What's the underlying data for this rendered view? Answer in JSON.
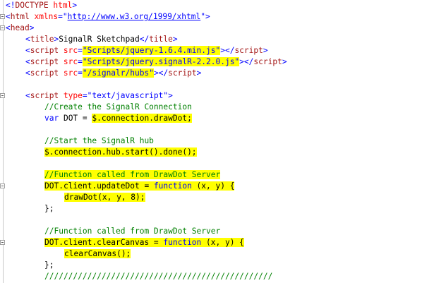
{
  "lines": [
    [
      [
        "<!",
        "c-blue"
      ],
      [
        "DOCTYPE",
        "c-maroon"
      ],
      [
        " ",
        "c-black"
      ],
      [
        "html",
        "c-red"
      ],
      [
        ">",
        "c-blue"
      ]
    ],
    [
      [
        "<",
        "c-blue"
      ],
      [
        "html",
        "c-maroon"
      ],
      [
        " ",
        "c-black"
      ],
      [
        "xmlns",
        "c-red"
      ],
      [
        "=\"",
        "c-blue"
      ],
      [
        "http://www.w3.org/1999/xhtml",
        "c-link"
      ],
      [
        "\">",
        "c-blue"
      ]
    ],
    [
      [
        "<",
        "c-blue"
      ],
      [
        "head",
        "c-maroon"
      ],
      [
        ">",
        "c-blue"
      ]
    ],
    [
      [
        "<",
        "c-blue"
      ],
      [
        "title",
        "c-maroon"
      ],
      [
        ">",
        "c-blue"
      ],
      [
        "SignalR Sketchpad",
        "c-black"
      ],
      [
        "</",
        "c-blue"
      ],
      [
        "title",
        "c-maroon"
      ],
      [
        ">",
        "c-blue"
      ]
    ],
    [
      [
        "<",
        "c-blue"
      ],
      [
        "script",
        "c-maroon"
      ],
      [
        " ",
        "c-black"
      ],
      [
        "src",
        "c-red"
      ],
      [
        "=",
        "c-blue"
      ],
      [
        "\"Scripts/jquery-1.6.4.min.js\"",
        "c-blue hl"
      ],
      [
        "></",
        "c-blue"
      ],
      [
        "script",
        "c-maroon"
      ],
      [
        ">",
        "c-blue"
      ]
    ],
    [
      [
        "<",
        "c-blue"
      ],
      [
        "script",
        "c-maroon"
      ],
      [
        " ",
        "c-black"
      ],
      [
        "src",
        "c-red"
      ],
      [
        "=",
        "c-blue"
      ],
      [
        "\"Scripts/jquery.signalR-2.2.0.js\"",
        "c-blue hl"
      ],
      [
        "></",
        "c-blue"
      ],
      [
        "script",
        "c-maroon"
      ],
      [
        ">",
        "c-blue"
      ]
    ],
    [
      [
        "<",
        "c-blue"
      ],
      [
        "script",
        "c-maroon"
      ],
      [
        " ",
        "c-black"
      ],
      [
        "src",
        "c-red"
      ],
      [
        "=",
        "c-blue"
      ],
      [
        "\"/signalr/hubs\"",
        "c-blue hl"
      ],
      [
        "></",
        "c-blue"
      ],
      [
        "script",
        "c-maroon"
      ],
      [
        ">",
        "c-blue"
      ]
    ],
    [],
    [
      [
        "<",
        "c-blue"
      ],
      [
        "script",
        "c-maroon"
      ],
      [
        " ",
        "c-black"
      ],
      [
        "type",
        "c-red"
      ],
      [
        "=\"",
        "c-blue"
      ],
      [
        "text/javascript",
        "c-blue"
      ],
      [
        "\">",
        "c-blue"
      ]
    ],
    [
      [
        "//Create the SignalR Connection",
        "c-green"
      ]
    ],
    [
      [
        "var",
        "c-blue"
      ],
      [
        " DOT = ",
        "c-black"
      ],
      [
        "$.connection.drawDot;",
        "c-black hl"
      ]
    ],
    [],
    [
      [
        "//Start the SignalR hub",
        "c-green"
      ]
    ],
    [
      [
        "$.connection.hub.start().done();",
        "c-black hl"
      ]
    ],
    [],
    [
      [
        "//Function called from DrawDot Server",
        "c-green hl"
      ]
    ],
    [
      [
        "DOT.client.updateDot = ",
        "c-black hl"
      ],
      [
        "function",
        "c-blue hl"
      ],
      [
        " (x, y) {",
        "c-black hl"
      ]
    ],
    [
      [
        "drawDot(x, y, 8);",
        "c-black hl"
      ]
    ],
    [
      [
        "};",
        "c-black"
      ]
    ],
    [],
    [
      [
        "//Function called from DrawDot Server",
        "c-green"
      ]
    ],
    [
      [
        "DOT.client.clearCanvas = ",
        "c-black hl"
      ],
      [
        "function",
        "c-blue hl"
      ],
      [
        " (x, y) {",
        "c-black hl"
      ]
    ],
    [
      [
        "clearCanvas();",
        "c-black hl"
      ]
    ],
    [
      [
        "};",
        "c-black"
      ]
    ],
    [
      [
        "////////////////////////////////////////////////",
        "c-green"
      ]
    ]
  ]
}
